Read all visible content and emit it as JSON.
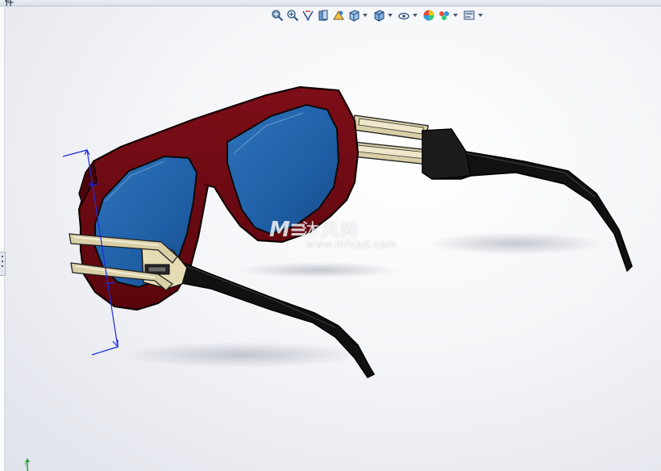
{
  "window": {
    "tab_fragment": "件"
  },
  "heads_up_toolbar": {
    "items": [
      {
        "icon": "zoom-to-fit-icon",
        "has_dropdown": false
      },
      {
        "icon": "zoom-to-area-icon",
        "has_dropdown": false
      },
      {
        "icon": "previous-view-icon",
        "has_dropdown": false
      },
      {
        "icon": "section-view-icon",
        "has_dropdown": false
      },
      {
        "icon": "dynamic-annotation-views-icon",
        "has_dropdown": false
      },
      {
        "icon": "view-orientation-icon",
        "has_dropdown": true
      },
      {
        "icon": "display-style-icon",
        "has_dropdown": true
      },
      {
        "icon": "hide-show-items-icon",
        "has_dropdown": true
      },
      {
        "icon": "edit-appearance-icon",
        "has_dropdown": false
      },
      {
        "icon": "apply-scene-icon",
        "has_dropdown": true
      },
      {
        "icon": "view-settings-icon",
        "has_dropdown": true
      }
    ]
  },
  "watermark": {
    "mark": "M≡",
    "chinese": "沐风网",
    "url": "www.mfcad.com"
  },
  "colors": {
    "frame": "#6e0a12",
    "lens": "#1f5fa6",
    "arm": "#0e0e0e",
    "hinge_gold": "#d9cfa6",
    "dimension_line": "#1c2bd8",
    "triad_axis": "#2a9d3a"
  }
}
